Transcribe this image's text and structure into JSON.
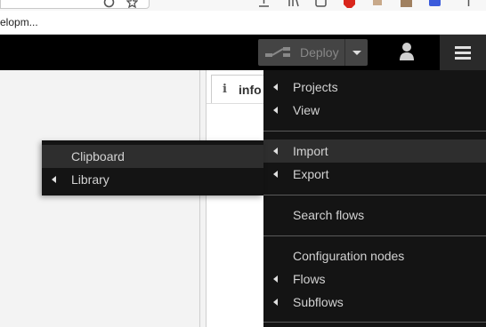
{
  "browser": {
    "bookmark_label": "elopm...",
    "toolbar_icons": [
      "minus-icon",
      "circle-icon",
      "star-icon",
      "download-icon",
      "library-icon",
      "tab-icon",
      "stop-icon",
      "extension-icon",
      "profile-icon",
      "puzzle-icon",
      "menu-icon"
    ]
  },
  "header": {
    "deploy_label": "Deploy",
    "deploy_icon": "deploy-icon",
    "user_icon": "user-icon",
    "menu_icon": "hamburger-icon",
    "background": "#000000"
  },
  "sidebar": {
    "tab_icon": "i",
    "tab_label": "info"
  },
  "main_menu": {
    "items": [
      {
        "label": "Projects",
        "has_submenu": true
      },
      {
        "label": "View",
        "has_submenu": true
      },
      {
        "label": "Import",
        "has_submenu": true,
        "active": true
      },
      {
        "label": "Export",
        "has_submenu": true
      },
      {
        "label": "Search flows",
        "has_submenu": false
      },
      {
        "label": "Configuration nodes",
        "has_submenu": false
      },
      {
        "label": "Flows",
        "has_submenu": true
      },
      {
        "label": "Subflows",
        "has_submenu": true
      }
    ]
  },
  "import_submenu": {
    "items": [
      {
        "label": "Clipboard",
        "has_submenu": false,
        "active": true
      },
      {
        "label": "Library",
        "has_submenu": true
      }
    ]
  },
  "colors": {
    "menu_bg": "#141414",
    "menu_active_bg": "#2e2e2e",
    "menu_text": "#d2d2d2",
    "deploy_bg": "#444444"
  }
}
